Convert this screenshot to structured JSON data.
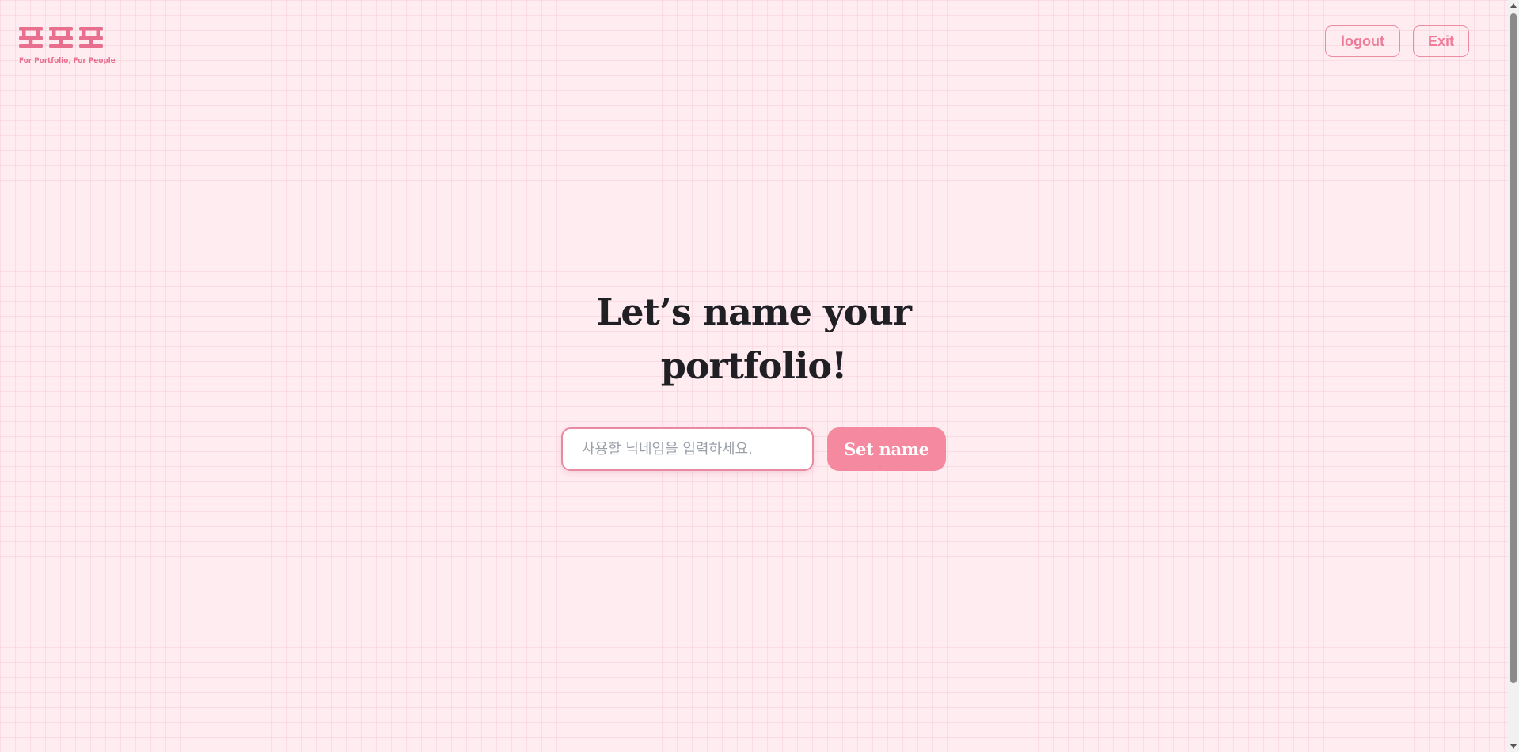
{
  "logo": {
    "wordmark": "포포포",
    "tagline": "For Portfolio, For People",
    "color": "#e8708e"
  },
  "header": {
    "logout_label": "logout",
    "exit_label": "Exit"
  },
  "main": {
    "headline": "Let’s name your portfolio!",
    "input_placeholder": "사용할 닉네임을 입력하세요.",
    "input_value": "",
    "submit_label": "Set name"
  },
  "colors": {
    "background": "#ffecf1",
    "accent": "#f4899f",
    "outline": "#ee8ca4",
    "headline": "#1f1f24"
  },
  "icons": {
    "scroll_up": "triangle-up-icon",
    "scroll_down": "triangle-down-icon"
  }
}
